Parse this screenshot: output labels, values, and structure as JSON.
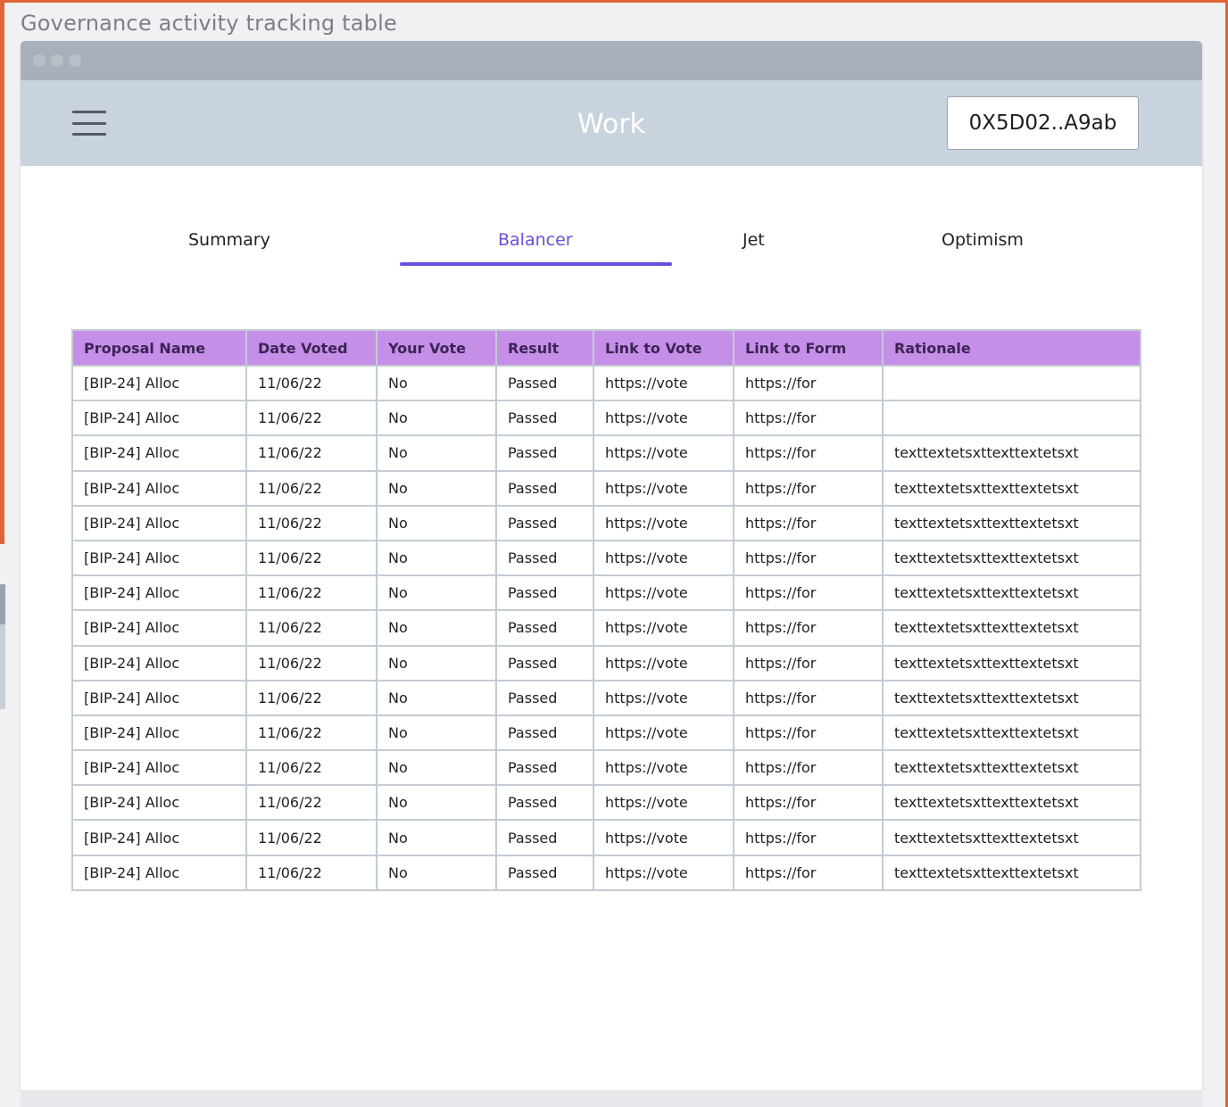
{
  "frame": {
    "title": "Governance activity tracking table"
  },
  "header": {
    "title": "Work",
    "wallet_label": "0X5D02..A9ab"
  },
  "tabs": [
    {
      "label": "Summary",
      "active": false
    },
    {
      "label": "Balancer",
      "active": true
    },
    {
      "label": "Jet",
      "active": false
    },
    {
      "label": "Optimism",
      "active": false
    }
  ],
  "colors": {
    "accent": "#6a4de0",
    "table_header": "#c58fe8",
    "appbar": "#c9d3dd",
    "frame": "#e0643a"
  },
  "table": {
    "columns": [
      "Proposal Name",
      "Date Voted",
      "Your Vote",
      "Result",
      "Link to Vote",
      "Link to Form",
      "Rationale"
    ],
    "rows": [
      [
        "[BIP-24] Alloc",
        "11/06/22",
        "No",
        "Passed",
        "https://vote",
        "https://for",
        ""
      ],
      [
        "[BIP-24] Alloc",
        "11/06/22",
        "No",
        "Passed",
        "https://vote",
        "https://for",
        ""
      ],
      [
        "[BIP-24] Alloc",
        "11/06/22",
        "No",
        "Passed",
        "https://vote",
        "https://for",
        "texttextetsxttexttextetsxt"
      ],
      [
        "[BIP-24] Alloc",
        "11/06/22",
        "No",
        "Passed",
        "https://vote",
        "https://for",
        "texttextetsxttexttextetsxt"
      ],
      [
        "[BIP-24] Alloc",
        "11/06/22",
        "No",
        "Passed",
        "https://vote",
        "https://for",
        "texttextetsxttexttextetsxt"
      ],
      [
        "[BIP-24] Alloc",
        "11/06/22",
        "No",
        "Passed",
        "https://vote",
        "https://for",
        "texttextetsxttexttextetsxt"
      ],
      [
        "[BIP-24] Alloc",
        "11/06/22",
        "No",
        "Passed",
        "https://vote",
        "https://for",
        "texttextetsxttexttextetsxt"
      ],
      [
        "[BIP-24] Alloc",
        "11/06/22",
        "No",
        "Passed",
        "https://vote",
        "https://for",
        "texttextetsxttexttextetsxt"
      ],
      [
        "[BIP-24] Alloc",
        "11/06/22",
        "No",
        "Passed",
        "https://vote",
        "https://for",
        "texttextetsxttexttextetsxt"
      ],
      [
        "[BIP-24] Alloc",
        "11/06/22",
        "No",
        "Passed",
        "https://vote",
        "https://for",
        "texttextetsxttexttextetsxt"
      ],
      [
        "[BIP-24] Alloc",
        "11/06/22",
        "No",
        "Passed",
        "https://vote",
        "https://for",
        "texttextetsxttexttextetsxt"
      ],
      [
        "[BIP-24] Alloc",
        "11/06/22",
        "No",
        "Passed",
        "https://vote",
        "https://for",
        "texttextetsxttexttextetsxt"
      ],
      [
        "[BIP-24] Alloc",
        "11/06/22",
        "No",
        "Passed",
        "https://vote",
        "https://for",
        "texttextetsxttexttextetsxt"
      ],
      [
        "[BIP-24] Alloc",
        "11/06/22",
        "No",
        "Passed",
        "https://vote",
        "https://for",
        "texttextetsxttexttextetsxt"
      ],
      [
        "[BIP-24] Alloc",
        "11/06/22",
        "No",
        "Passed",
        "https://vote",
        "https://for",
        "texttextetsxttexttextetsxt"
      ]
    ]
  }
}
